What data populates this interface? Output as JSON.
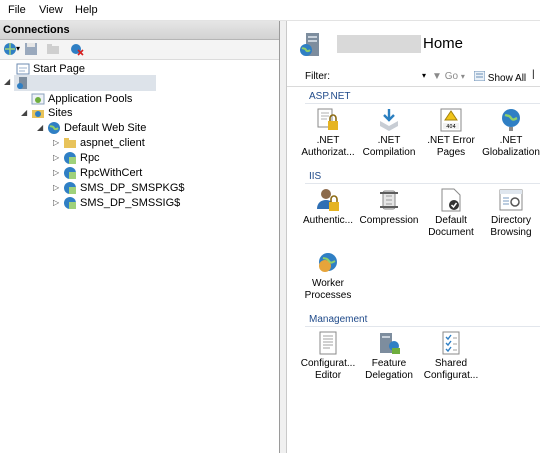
{
  "menubar": {
    "items": [
      "File",
      "View",
      "Help"
    ]
  },
  "connections": {
    "header": "Connections",
    "tree": {
      "start_page": "Start Page",
      "app_pools": "Application Pools",
      "sites": "Sites",
      "default_site": "Default Web Site",
      "children": [
        "aspnet_client",
        "Rpc",
        "RpcWithCert",
        "SMS_DP_SMSPKG$",
        "SMS_DP_SMSSIG$"
      ]
    }
  },
  "home": {
    "title_suffix": "Home",
    "filter": {
      "label": "Filter:",
      "value": "",
      "go": "Go",
      "show_all": "Show All"
    },
    "sections": {
      "aspnet": {
        "label": "ASP.NET",
        "features": [
          {
            "line1": ".NET",
            "line2": "Authorizat..."
          },
          {
            "line1": ".NET",
            "line2": "Compilation"
          },
          {
            "line1": ".NET Error",
            "line2": "Pages"
          },
          {
            "line1": ".NET",
            "line2": "Globalization"
          }
        ]
      },
      "iis": {
        "label": "IIS",
        "features": [
          {
            "line1": "Authentic...",
            "line2": ""
          },
          {
            "line1": "Compression",
            "line2": ""
          },
          {
            "line1": "Default",
            "line2": "Document"
          },
          {
            "line1": "Directory",
            "line2": "Browsing"
          },
          {
            "line1": "Worker",
            "line2": "Processes"
          }
        ]
      },
      "management": {
        "label": "Management",
        "features": [
          {
            "line1": "Configurat...",
            "line2": "Editor"
          },
          {
            "line1": "Feature",
            "line2": "Delegation"
          },
          {
            "line1": "Shared",
            "line2": "Configurat..."
          }
        ]
      }
    }
  },
  "colors": {
    "section_label": "#1f4a8a",
    "globe": "#2f7fc4",
    "folder": "#e8c35a"
  }
}
